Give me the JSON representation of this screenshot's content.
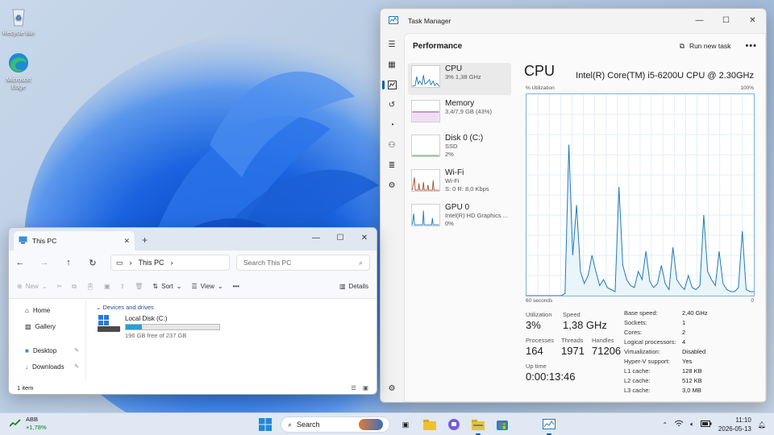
{
  "desktop": {
    "icons": [
      {
        "label": "Recycle Bin"
      },
      {
        "label": "Microsoft Edge"
      }
    ]
  },
  "task_manager": {
    "title": "Task Manager",
    "page_title": "Performance",
    "run_new_task": "Run new task",
    "more": "•••",
    "window_controls": {
      "minimize": "—",
      "maximize": "☐",
      "close": "✕"
    },
    "rail": [
      "menu-icon",
      "processes-icon",
      "performance-icon",
      "app-history-icon",
      "startup-icon",
      "users-icon",
      "details-icon",
      "services-icon",
      "settings-icon"
    ],
    "resources": [
      {
        "name": "CPU",
        "line1": "3%  1,38 GHz",
        "line2": "",
        "color": "#1f7ab8"
      },
      {
        "name": "Memory",
        "line1": "3,4/7,9 GB (43%)",
        "line2": "",
        "color": "#8b2a9b"
      },
      {
        "name": "Disk 0 (C:)",
        "line1": "SSD",
        "line2": "2%",
        "color": "#2e8b2e"
      },
      {
        "name": "Wi-Fi",
        "line1": "Wi-Fi",
        "line2": "S: 0  R: 8,0 Kbps",
        "color": "#a0522d"
      },
      {
        "name": "GPU 0",
        "line1": "Intel(R) HD Graphics ...",
        "line2": "0%",
        "color": "#1f7ab8"
      }
    ],
    "cpu": {
      "title": "CPU",
      "model": "Intel(R) Core(TM) i5-6200U CPU @ 2.30GHz",
      "util_label": "% Utilization",
      "util_max": "100%",
      "x_left": "60 seconds",
      "x_right": "0",
      "utilization_history": [
        0,
        0,
        0,
        0,
        0,
        0,
        0,
        0,
        0,
        0,
        1,
        75,
        20,
        45,
        12,
        6,
        10,
        20,
        12,
        5,
        8,
        4,
        3,
        2,
        54,
        15,
        8,
        5,
        4,
        12,
        8,
        22,
        7,
        4,
        6,
        15,
        6,
        3,
        24,
        8,
        5,
        3,
        10,
        4,
        3,
        5,
        40,
        12,
        8,
        5,
        22,
        6,
        3,
        2,
        2,
        4,
        32,
        3,
        2,
        2
      ],
      "stats": {
        "utilization": {
          "label": "Utilization",
          "value": "3%"
        },
        "speed": {
          "label": "Speed",
          "value": "1,38 GHz"
        },
        "processes": {
          "label": "Processes",
          "value": "164"
        },
        "threads": {
          "label": "Threads",
          "value": "1971"
        },
        "handles": {
          "label": "Handles",
          "value": "71206"
        },
        "uptime": {
          "label": "Up time",
          "value": "0:00:13:46"
        }
      },
      "specs": [
        {
          "k": "Base speed:",
          "v": "2,40 GHz"
        },
        {
          "k": "Sockets:",
          "v": "1"
        },
        {
          "k": "Cores:",
          "v": "2"
        },
        {
          "k": "Logical processors:",
          "v": "4"
        },
        {
          "k": "Virtualization:",
          "v": "Disabled"
        },
        {
          "k": "Hyper-V support:",
          "v": "Yes"
        },
        {
          "k": "L1 cache:",
          "v": "128 KB"
        },
        {
          "k": "L2 cache:",
          "v": "512 KB"
        },
        {
          "k": "L3 cache:",
          "v": "3,0 MB"
        }
      ]
    }
  },
  "file_explorer": {
    "tab_title": "This PC",
    "tab_close": "✕",
    "new_tab": "+",
    "window_controls": {
      "minimize": "—",
      "maximize": "☐",
      "close": "✕"
    },
    "address": "This PC",
    "search_placeholder": "Search This PC",
    "toolbar": {
      "new": "New",
      "sort": "Sort",
      "view": "View",
      "more": "•••",
      "details": "Details"
    },
    "nav_pane": [
      {
        "label": "Home",
        "pinned": false
      },
      {
        "label": "Gallery",
        "pinned": false
      },
      {
        "label": "Desktop",
        "pinned": true
      },
      {
        "label": "Downloads",
        "pinned": true
      }
    ],
    "group_label": "Devices and drives",
    "drive": {
      "label": "Local Disk (C:)",
      "free_text": "196 GB free of 237 GB",
      "used_fraction": 0.173
    },
    "status": "1 item"
  },
  "taskbar": {
    "ticker_name": "ABB",
    "ticker_change": "+1,78%",
    "search_label": "Search",
    "time": "11:10",
    "date": "2026-05-13"
  }
}
